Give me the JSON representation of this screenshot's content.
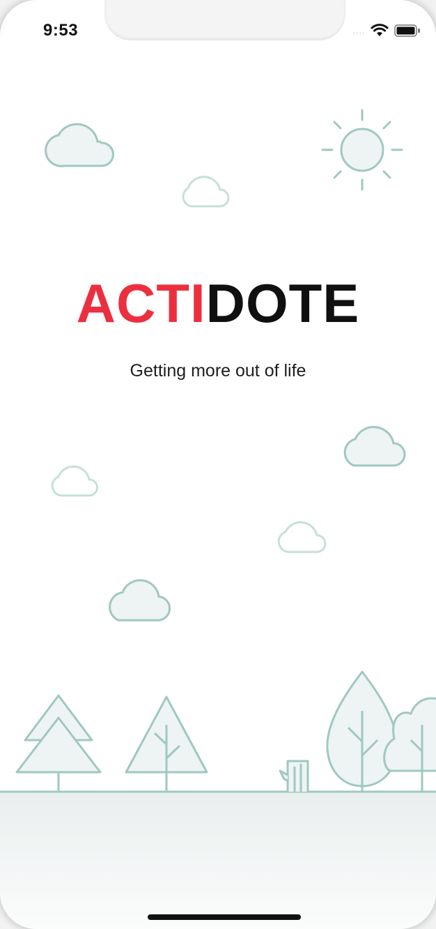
{
  "status_bar": {
    "time": "9:53",
    "signal_dots": "....",
    "icons": [
      "wifi-icon",
      "battery-icon"
    ]
  },
  "logo": {
    "part_red": "ACTI",
    "part_black": "DOTE"
  },
  "tagline": "Getting more out of life",
  "colors": {
    "accent_red": "#ec2f3f",
    "illustration_stroke": "#9fc8c0",
    "illustration_fill": "#eef3f3",
    "text_dark": "#101010"
  }
}
